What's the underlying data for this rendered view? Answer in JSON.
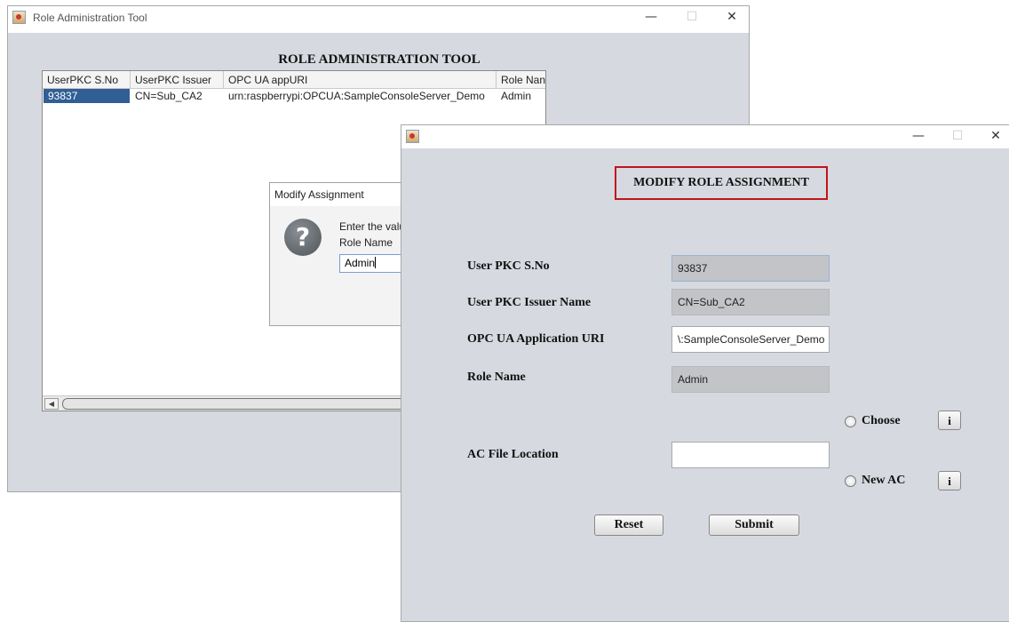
{
  "main_window": {
    "title": "Role Administration Tool",
    "header": "ROLE ADMINISTRATION TOOL",
    "table": {
      "columns": [
        "UserPKC S.No",
        "UserPKC Issuer",
        "OPC UA appURI",
        "Role Nan"
      ],
      "rows": [
        [
          "93837",
          "CN=Sub_CA2",
          "urn:raspberrypi:OPCUA:SampleConsoleServer_Demo",
          "Admin"
        ]
      ]
    }
  },
  "dialog": {
    "title": "Modify Assignment",
    "message": "Enter the value",
    "field_label": "Role Name",
    "input_value": "Admin"
  },
  "modify_window": {
    "title": "",
    "header": "MODIFY ROLE ASSIGNMENT",
    "header_border_color": "#c0141c",
    "fields": {
      "sno_label": "User PKC S.No",
      "sno_value": "93837",
      "issuer_label": "User PKC Issuer Name",
      "issuer_value": "CN=Sub_CA2",
      "uri_label": "OPC UA Application URI",
      "uri_value": "\\:SampleConsoleServer_Demo",
      "role_label": "Role Name",
      "role_value": "Admin",
      "ac_label": "AC File Location",
      "ac_value": ""
    },
    "options": {
      "choose": "Choose",
      "new_ac": "New AC",
      "info": "i"
    },
    "buttons": {
      "reset": "Reset",
      "submit": "Submit"
    }
  },
  "window_controls": {
    "minimize": "—",
    "maximize": "☐",
    "close": "✕"
  }
}
